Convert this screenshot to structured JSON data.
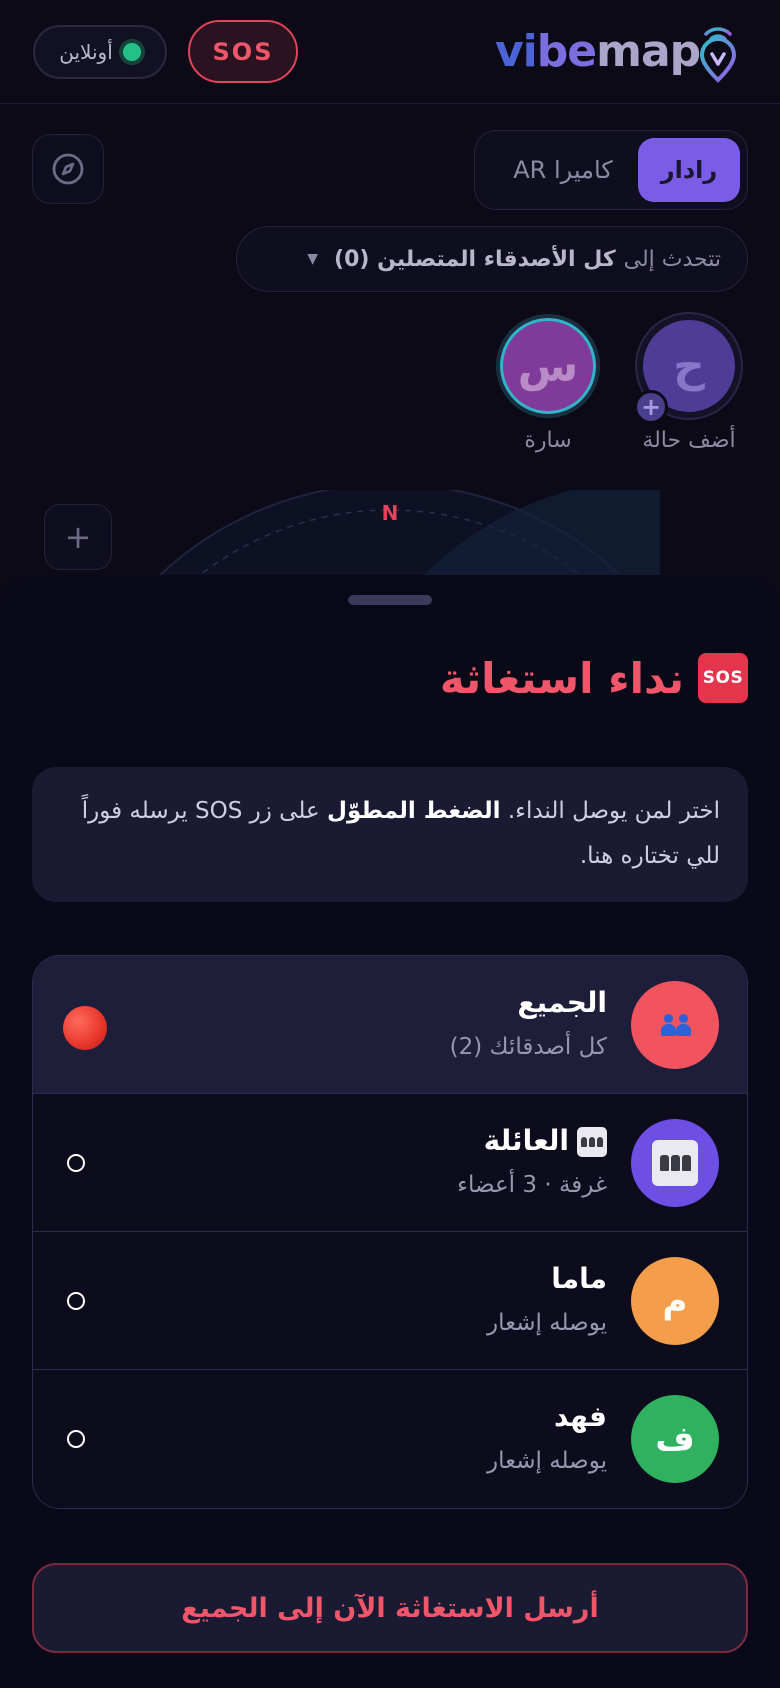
{
  "header": {
    "online_label": "أونلاين",
    "sos_label": "SOS",
    "brand": {
      "part1": "vi",
      "part2": "be",
      "part3": "map"
    }
  },
  "radar": {
    "modes": [
      {
        "label": "رادار",
        "active": true
      },
      {
        "label": "كاميرا AR",
        "active": false
      }
    ],
    "talk": {
      "prefix": "تتحدث إلى",
      "target": "كل الأصدقاء المتصلين (0)"
    },
    "avatars": [
      {
        "initial": "ح",
        "label": "أضف حالة"
      },
      {
        "initial": "س",
        "label": "سارة"
      }
    ],
    "north_label": "N",
    "zoom_label": "+"
  },
  "sheet": {
    "title": "نداء استغاثة",
    "title_emoji": "SOS",
    "info": {
      "part1": "اختر لمن يوصل النداء.",
      "bold": "الضغط المطوّل",
      "part2": "على زر SOS يرسله فوراً للي تختاره هنا."
    },
    "recipients": [
      {
        "title": "الجميع",
        "subtitle": "كل أصدقائك (2)",
        "avatar_color": "#f2545f",
        "icon": "people-icon",
        "selected": true
      },
      {
        "title": "العائلة",
        "subtitle": "غرفة · 3 أعضاء",
        "avatar_color": "#6d4fe6",
        "icon": "family-icon",
        "selected": false
      },
      {
        "title": "ماما",
        "subtitle": "يوصله إشعار",
        "initial": "م",
        "avatar_color": "#f49d4a",
        "selected": false
      },
      {
        "title": "فهد",
        "subtitle": "يوصله إشعار",
        "initial": "ف",
        "avatar_color": "#2fb160",
        "selected": false
      }
    ],
    "send_label": "أرسل الاستغاثة الآن إلى الجميع"
  },
  "colors": {
    "accent_red": "#f0566a",
    "accent_purple": "#7b5ce6",
    "background": "#0b0a16"
  }
}
